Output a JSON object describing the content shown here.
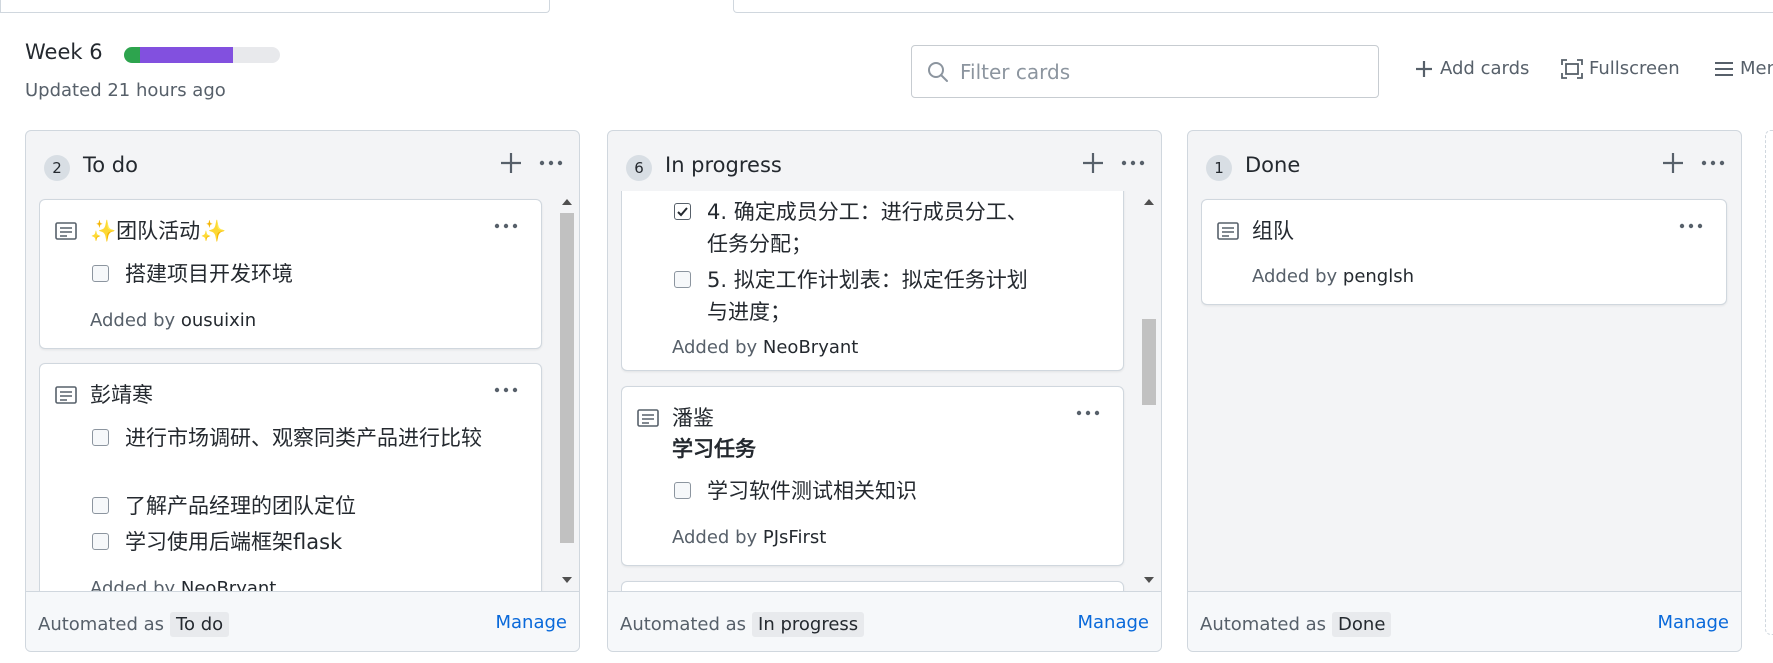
{
  "header": {
    "title": "Week 6",
    "updated": "Updated 21 hours ago",
    "progress": {
      "done_fraction": 0.105,
      "in_progress_fraction": 0.595,
      "colors": {
        "done": "#2da44e",
        "in_progress": "#8250df",
        "track": "#e8e9ec"
      }
    }
  },
  "toolbar": {
    "filter_placeholder": "Filter cards",
    "add_cards": "Add cards",
    "fullscreen": "Fullscreen",
    "menu": "Men"
  },
  "columns": [
    {
      "count": "2",
      "name": "To do",
      "automated_label": "Automated as",
      "automated_value": "To do",
      "manage": "Manage",
      "cards": [
        {
          "icon": "note-icon",
          "title_prefix": "✨",
          "title": "团队活动",
          "title_suffix": "✨",
          "tasks": [
            {
              "checked": false,
              "text": "搭建项目开发环境"
            }
          ],
          "added_label": "Added by",
          "added_by": "ousuixin"
        },
        {
          "icon": "note-icon",
          "title": "彭靖寒",
          "tasks": [
            {
              "checked": false,
              "text": "进行市场调研、观察同类产品进行比较"
            },
            {
              "checked": false,
              "text": "了解产品经理的团队定位"
            },
            {
              "checked": false,
              "text": "学习使用后端框架flask"
            }
          ],
          "added_label": "Added by",
          "added_by": "NeoBryant"
        }
      ]
    },
    {
      "count": "6",
      "name": "In progress",
      "automated_label": "Automated as",
      "automated_value": "In progress",
      "manage": "Manage",
      "cards": [
        {
          "icon": "note-icon",
          "tasks": [
            {
              "checked": true,
              "text": "4. 确定成员分工：进行成员分工、任务分配；"
            },
            {
              "checked": false,
              "text": "5. 拟定工作计划表：拟定任务计划与进度；"
            }
          ],
          "added_label": "Added by",
          "added_by": "NeoBryant"
        },
        {
          "icon": "note-icon",
          "title": "潘鉴",
          "subtitle": "学习任务",
          "tasks": [
            {
              "checked": false,
              "text": "学习软件测试相关知识"
            }
          ],
          "added_label": "Added by",
          "added_by": "PJsFirst"
        }
      ]
    },
    {
      "count": "1",
      "name": "Done",
      "automated_label": "Automated as",
      "automated_value": "Done",
      "manage": "Manage",
      "cards": [
        {
          "icon": "note-icon",
          "title": "组队",
          "added_label": "Added by",
          "added_by": "penglsh"
        }
      ]
    }
  ],
  "colors": {
    "link": "#0969da",
    "column_bg": "#f3f4f6",
    "border": "#d0d7de"
  }
}
